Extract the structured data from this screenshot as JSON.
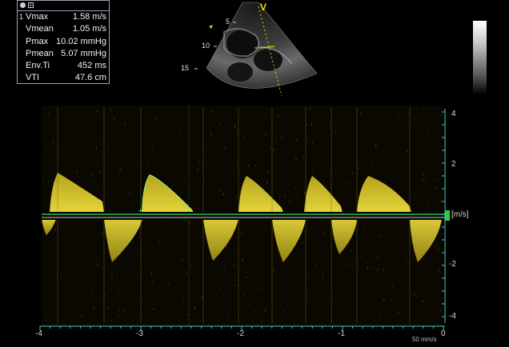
{
  "measurement_panel": {
    "index": "1",
    "rows": [
      {
        "label": "Vmax",
        "value": "1.58 m/s"
      },
      {
        "label": "Vmean",
        "value": "1.05 m/s"
      },
      {
        "label": "Pmax",
        "value": "10.02 mmHg"
      },
      {
        "label": "Pmean",
        "value": "5.07 mmHg"
      },
      {
        "label": "Env.Ti",
        "value": "452 ms"
      },
      {
        "label": "VTI",
        "value": "47.6 cm"
      }
    ]
  },
  "sector": {
    "depth_marks": [
      "5",
      "10",
      "15"
    ],
    "direction_label": "V"
  },
  "spectral": {
    "velocity_ticks": [
      "4",
      "2",
      "-2",
      "-4"
    ],
    "velocity_unit": "[m/s]",
    "time_ticks": [
      "-4",
      "-3",
      "-2",
      "-1",
      "0"
    ],
    "sweep_speed": "50 mm/s",
    "colors": {
      "signal": "#e8d420",
      "baseline": "#2fb84a",
      "axis": "#3ad0c0",
      "trace": "#8cf07a"
    }
  }
}
